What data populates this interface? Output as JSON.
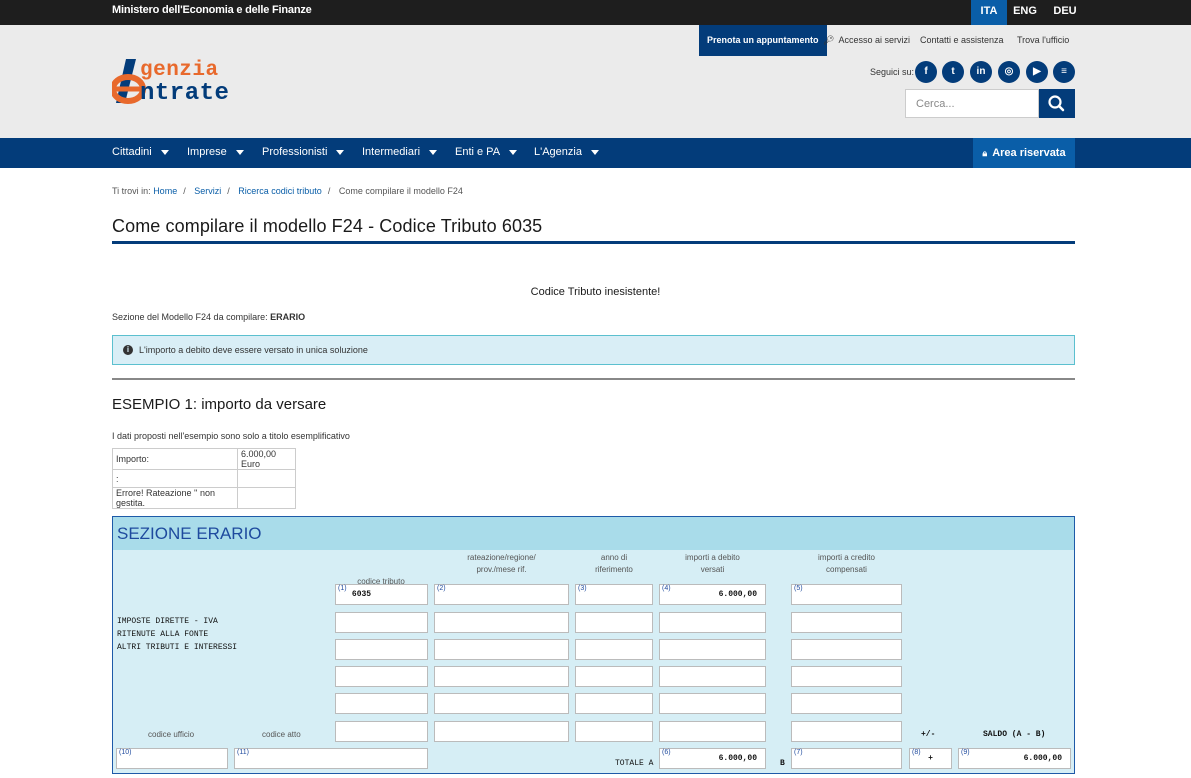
{
  "topbar": {
    "ministry": "Ministero dell'Economia e delle Finanze",
    "languages": [
      "ITA",
      "ENG",
      "DEU"
    ]
  },
  "logo": {
    "line1": "genzia",
    "line2": "ntrate"
  },
  "utility": {
    "appointment": "Prenota un appuntamento",
    "access": "Accesso ai servizi",
    "contacts": "Contatti e assistenza",
    "office": "Trova l'ufficio"
  },
  "social": {
    "label": "Seguici su:",
    "icons": [
      "facebook-icon",
      "twitter-icon",
      "linkedin-icon",
      "instagram-icon",
      "youtube-icon",
      "rss-icon"
    ]
  },
  "search": {
    "placeholder": "Cerca..."
  },
  "nav": {
    "items": [
      "Cittadini",
      "Imprese",
      "Professionisti",
      "Intermediari",
      "Enti e PA",
      "L'Agenzia"
    ],
    "reserved": "Area riservata"
  },
  "breadcrumb": {
    "prefix": "Ti trovi in:",
    "home": "Home",
    "servizi": "Servizi",
    "ricerca": "Ricerca codici tributo",
    "current": "Come compilare il modello F24"
  },
  "page": {
    "title": "Come compilare il modello F24 - Codice Tributo 6035",
    "message": "Codice Tributo inesistente!",
    "section_label": "Sezione del Modello F24 da compilare:",
    "section_value": "ERARIO",
    "alert": "L'importo a debito deve essere versato in unica soluzione"
  },
  "example": {
    "title": "ESEMPIO 1: importo da versare",
    "disclaimer": "I dati proposti nell'esempio sono solo a titolo esemplificativo",
    "rows": [
      [
        "Importo:",
        "6.000,00 Euro"
      ],
      [
        ":",
        ""
      ],
      [
        "Errore! Rateazione '' non gestita.",
        ""
      ]
    ]
  },
  "f24": {
    "title": "SEZIONE ERARIO",
    "headers": {
      "codice_tributo": "codice tributo",
      "rateazione_1": "rateazione/regione/",
      "rateazione_2": "prov./mese rif.",
      "anno_1": "anno di",
      "anno_2": "riferimento",
      "debito_1": "importi a debito",
      "debito_2": "versati",
      "credito_1": "importi a credito",
      "credito_2": "compensati"
    },
    "side_text": [
      "IMPOSTE DIRETTE - IVA",
      "RITENUTE ALLA FONTE",
      "ALTRI TRIBUTI E INTERESSI"
    ],
    "nums": {
      "n1": "(1)",
      "n2": "(2)",
      "n3": "(3)",
      "n4": "(4)",
      "n5": "(5)",
      "n6": "(6)",
      "n7": "(7)",
      "n8": "(8)",
      "n9": "(9)",
      "n10": "(10)",
      "n11": "(11)"
    },
    "codice_tributo": "6035",
    "importo_debito": "6.000,00",
    "codice_ufficio": "codice ufficio",
    "codice_atto": "codice atto",
    "totale_a": "TOTALE A",
    "b": "B",
    "totale_a_value": "6.000,00",
    "segno_label": "+/-",
    "segno": "+",
    "saldo_label": "SALDO (A - B)",
    "saldo_value": "6.000,00"
  }
}
